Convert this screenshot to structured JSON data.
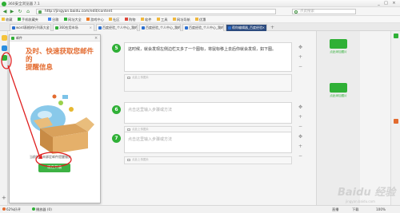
{
  "window": {
    "title": "360安全浏览器 7.1",
    "controls": [
      "_",
      "□",
      "×"
    ]
  },
  "address_bar": {
    "url": "http://jingyan.baidu.com/edit/content",
    "search_placeholder": "点此搜索"
  },
  "bookmarks": [
    {
      "label": "收藏"
    },
    {
      "label": "手机收藏夹"
    },
    {
      "label": "谷歌"
    },
    {
      "label": "网址大全"
    },
    {
      "label": "游戏中心"
    },
    {
      "label": "社区"
    },
    {
      "label": "购物"
    },
    {
      "label": "软件"
    },
    {
      "label": "工具"
    },
    {
      "label": "网址导航"
    },
    {
      "label": "优惠"
    }
  ],
  "tabs": [
    {
      "label": "word表格的行列表大全",
      "active": false
    },
    {
      "label": "360应用市场",
      "active": false
    },
    {
      "label": "百度经验_个人中心_我的",
      "active": false
    },
    {
      "label": "百度经验_个人中心_我的",
      "active": false
    },
    {
      "label": "百度经验_个人中心_我的",
      "active": false
    },
    {
      "label": "帮你编辑器_百度经验",
      "active": true
    }
  ],
  "popup": {
    "header": "邮件",
    "title_line1": "及时、快速获取您邮件的",
    "title_line2": "提醒信息",
    "footer_text": "当前账号未绑定邮件提醒服务",
    "open_button": "现在开通",
    "close": "×"
  },
  "steps": [
    {
      "num": "5",
      "text": "这时候，就会发现左侧边栏又多了一个图标，将鼠标移上去后你就会发现，如下图。",
      "image_label": "点此上传图片"
    },
    {
      "num": "6",
      "text": "点击这里输入步骤或方法",
      "image_label": "点此上传图片"
    },
    {
      "num": "7",
      "text": "点击这里输入步骤或方法",
      "image_label": "点此上传图片"
    }
  ],
  "right_panel": {
    "items": [
      {
        "label": "点此添加图片"
      },
      {
        "label": "点此添加图片"
      }
    ]
  },
  "status_bar": {
    "left": "62%好评",
    "middle": "播放器 (0)",
    "right_items": [
      "直播",
      "下载",
      "100%"
    ]
  },
  "watermark": {
    "text": "Baidu 经验",
    "sub": "jingyan.baidu.com"
  },
  "colors": {
    "brand_green": "#2fb036",
    "active_tab": "#2b4a7e",
    "annotation_red": "#e02020",
    "popup_title": "#e36b2f"
  }
}
